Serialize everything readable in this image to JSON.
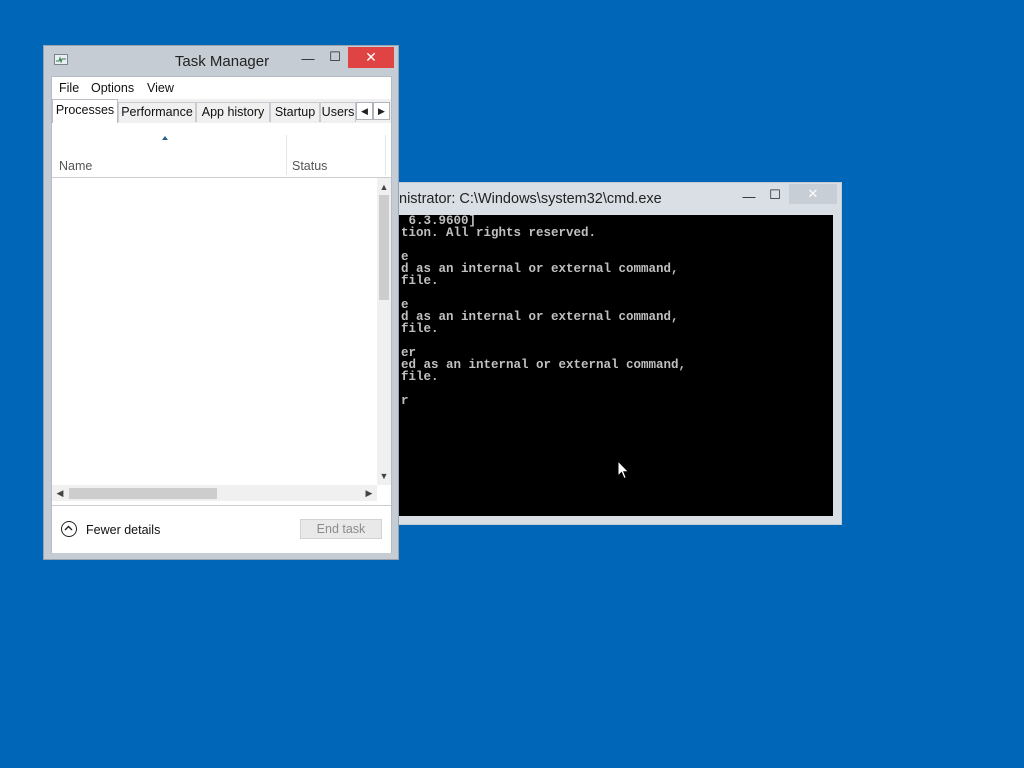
{
  "desktop": {
    "background": "#0067b8"
  },
  "cmd": {
    "title": "nistrator: C:\\Windows\\system32\\cmd.exe",
    "controls": {
      "minimize": "—",
      "maximize": "☐",
      "close": "✕"
    },
    "lines": [
      " 6.3.9600]",
      "tion. All rights reserved.",
      "",
      "e",
      "d as an internal or external command,",
      "file.",
      "",
      "e",
      "d as an internal or external command,",
      "file.",
      "",
      "er",
      "ed as an internal or external command,",
      "file.",
      "",
      "r"
    ]
  },
  "taskmanager": {
    "title": "Task Manager",
    "controls": {
      "minimize": "—",
      "maximize": "☐",
      "close": "✕"
    },
    "menu": [
      "File",
      "Options",
      "View"
    ],
    "tabs": [
      "Processes",
      "Performance",
      "App history",
      "Startup",
      "Users"
    ],
    "tab_scroll": {
      "left": "◀",
      "right": "▶"
    },
    "columns": {
      "name": "Name",
      "status": "Status"
    },
    "scroll_arrows": {
      "up": "▲",
      "down": "▼",
      "left": "◀",
      "right": "▶"
    },
    "footer": {
      "fewer_details": "Fewer details",
      "end_task": "End task"
    },
    "close_color": "#e04343"
  }
}
